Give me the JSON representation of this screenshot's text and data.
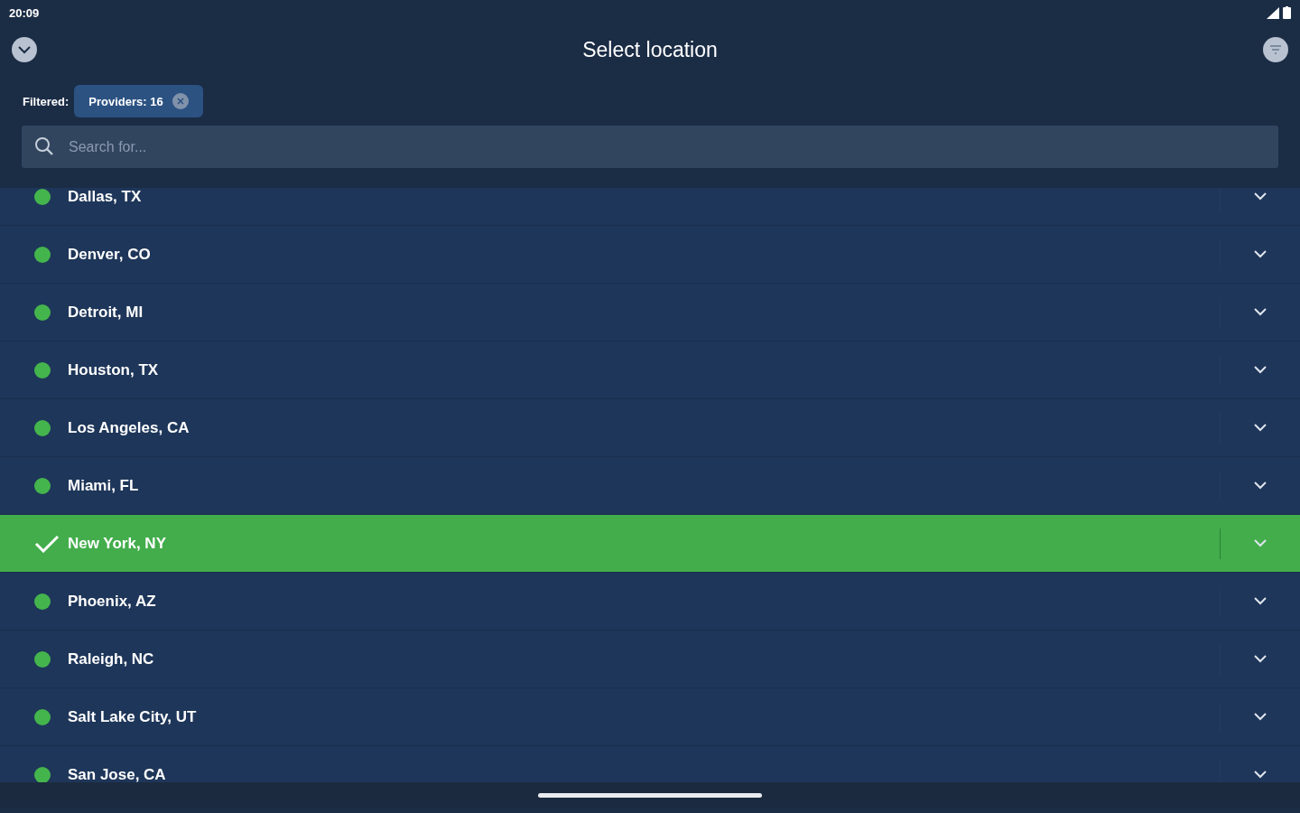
{
  "status_bar": {
    "time": "20:09"
  },
  "header": {
    "title": "Select location"
  },
  "filter": {
    "label": "Filtered:",
    "chips": [
      {
        "label": "Providers: 16"
      }
    ]
  },
  "search": {
    "placeholder": "Search for..."
  },
  "locations": [
    {
      "name": "Dallas, TX",
      "selected": false
    },
    {
      "name": "Denver, CO",
      "selected": false
    },
    {
      "name": "Detroit, MI",
      "selected": false
    },
    {
      "name": "Houston, TX",
      "selected": false
    },
    {
      "name": "Los Angeles, CA",
      "selected": false
    },
    {
      "name": "Miami, FL",
      "selected": false
    },
    {
      "name": "New York, NY",
      "selected": true
    },
    {
      "name": "Phoenix, AZ",
      "selected": false
    },
    {
      "name": "Raleigh, NC",
      "selected": false
    },
    {
      "name": "Salt Lake City, UT",
      "selected": false
    },
    {
      "name": "San Jose, CA",
      "selected": false
    }
  ]
}
